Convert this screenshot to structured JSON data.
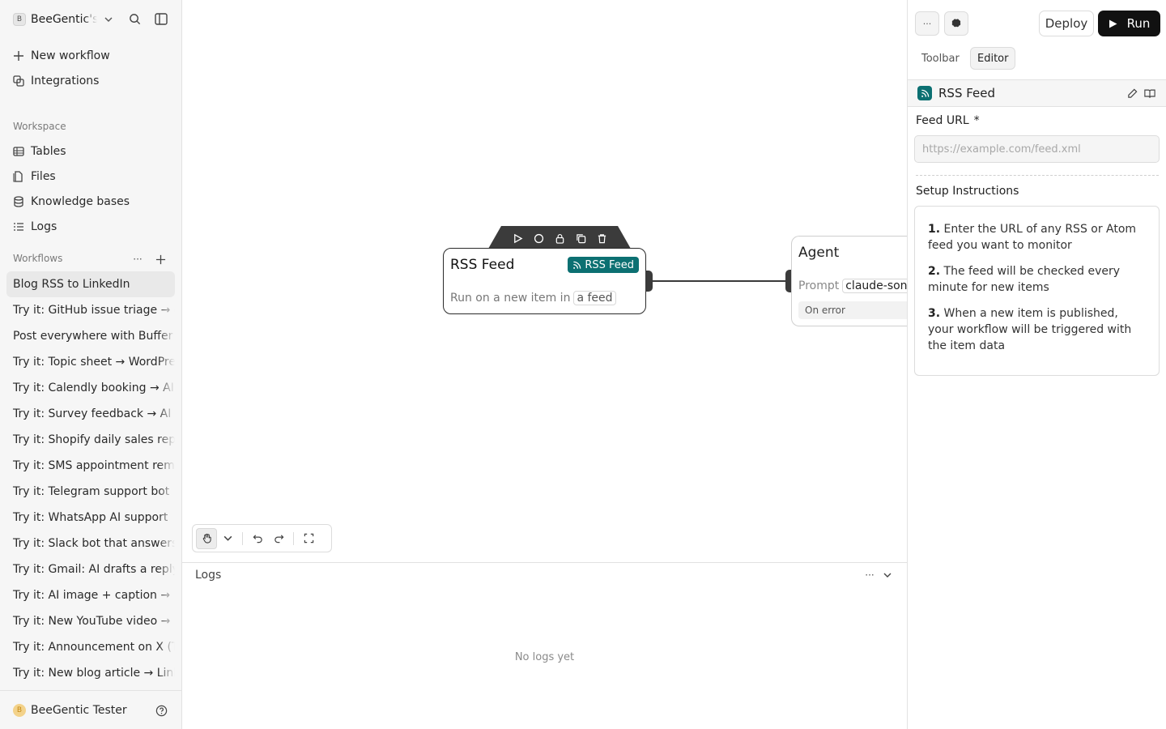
{
  "sidebar": {
    "workspace": {
      "avatar": "B",
      "name": "BeeGentic's Workspace"
    },
    "nav": [
      {
        "label": "New workflow",
        "icon": "plus-icon"
      },
      {
        "label": "Integrations",
        "icon": "integrations-icon"
      }
    ],
    "workspace_section": {
      "label": "Workspace",
      "items": [
        {
          "label": "Tables",
          "icon": "table-icon"
        },
        {
          "label": "Files",
          "icon": "files-icon"
        },
        {
          "label": "Knowledge bases",
          "icon": "database-icon"
        },
        {
          "label": "Logs",
          "icon": "list-icon"
        }
      ]
    },
    "workflows_section": {
      "label": "Workflows",
      "items": [
        "Blog RSS to LinkedIn",
        "Try it: GitHub issue triage → c",
        "Post everywhere with Buffer",
        "Try it: Topic sheet → WordPre",
        "Try it: Calendly booking → AI",
        "Try it: Survey feedback → AI s",
        "Try it: Shopify daily sales rep",
        "Try it: SMS appointment rem",
        "Try it: Telegram support bot",
        "Try it: WhatsApp AI support",
        "Try it: Slack bot that answers",
        "Try it: Gmail: AI drafts a reply",
        "Try it: AI image + caption → In",
        "Try it: New YouTube video →",
        "Try it: Announcement on X (T",
        "Try it: New blog article → Link"
      ],
      "active_index": 0
    },
    "user": {
      "avatar": "B",
      "name": "BeeGentic Tester"
    }
  },
  "canvas": {
    "rss_node": {
      "title": "RSS Feed",
      "badge": "RSS Feed",
      "subtitle": "Run on a new item in",
      "pill": "a feed"
    },
    "agent_node": {
      "title": "Agent",
      "prompt_label": "Prompt",
      "prompt_value": "claude-sonnet",
      "on_error": "On error"
    }
  },
  "logs": {
    "title": "Logs",
    "empty": "No logs yet"
  },
  "right_panel": {
    "more_label": "···",
    "deploy": "Deploy",
    "run": "Run",
    "tabs": [
      "Toolbar",
      "Editor"
    ],
    "active_tab": 1,
    "block": {
      "title": "RSS Feed",
      "field_label": "Feed URL",
      "required_mark": "*",
      "placeholder": "https://example.com/feed.xml",
      "value": "",
      "setup_label": "Setup Instructions",
      "steps": [
        {
          "num": "1.",
          "text": "Enter the URL of any RSS or Atom feed you want to monitor"
        },
        {
          "num": "2.",
          "text": "The feed will be checked every minute for new items"
        },
        {
          "num": "3.",
          "text": "When a new item is published, your workflow will be triggered with the item data"
        }
      ]
    }
  },
  "colors": {
    "accent": "#0c7072",
    "run_button": "#111111",
    "sidebar_bg": "#f6f6f6"
  }
}
